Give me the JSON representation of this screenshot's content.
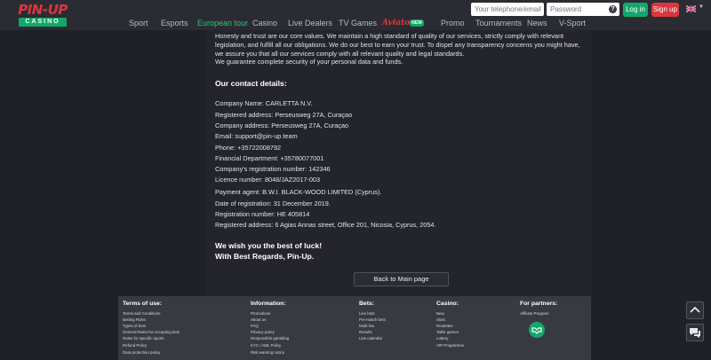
{
  "logo": {
    "top": "PIN-UP",
    "bottom": "CASINO"
  },
  "nav": {
    "items": [
      {
        "label": "Sport"
      },
      {
        "label": "Esports"
      },
      {
        "label": "European tour"
      },
      {
        "label": "Casino"
      },
      {
        "label": "Live Dealers"
      },
      {
        "label": "TV Games"
      },
      {
        "label": "Aviator"
      },
      {
        "label": "Promo"
      },
      {
        "label": "Tournaments"
      },
      {
        "label": "News"
      },
      {
        "label": "V-Sport"
      }
    ],
    "new_badge": "NEW"
  },
  "auth": {
    "phone_placeholder": "Your telephone/email",
    "password_placeholder": "Password",
    "help": "?",
    "login": "Log in",
    "signup": "Sign up"
  },
  "content": {
    "intro": "Honesty and trust are our core values. We maintain a high standard of quality of our services, strictly comply with relevant legislation, and fulfill all our obligations. We do our best to earn your trust. To dispel any transparency concerns you might have, we assure you that all our services comply with all relevant quality and legal standards.",
    "security": "We guarantee complete security of your personal data and funds.",
    "contact_heading": "Our contact details:",
    "details": [
      "Company Name: CARLETTA N.V.",
      "Registered address: Perseusweg 27A, Curaçao",
      "Company address: Perseusweg 27A, Curaçao",
      "Email: support@pin-up.team",
      "Phone: +35722008792",
      "Financial Department: +35780077001",
      "Company's registration number: 142346",
      "Licence number: 8048/JAZ2017-003"
    ],
    "agent": [
      "Payment agent: B.W.I. BLACK-WOOD LIMITED (Cyprus).",
      "Date of registration: 31 December 2019.",
      "Registration number: HE 405814",
      "Registered address: 6 Agias Annas street, Office 201, Nicosia, Cyprus, 2054."
    ],
    "closing_1": "We wish you the best of luck!",
    "closing_2": "With Best Regards, Pin-Up.",
    "back_button": "Back to Main page"
  },
  "footer": {
    "terms": {
      "title": "Terms of use:",
      "items": [
        "Terms and Conditions",
        "Betting Rules",
        "Types of bets",
        "General Rules for Accepting bets",
        "Rules for specific sports",
        "Refund Policy",
        "Data protection policy"
      ]
    },
    "information": {
      "title": "Information:",
      "items": [
        "Promotions",
        "About us",
        "FAQ",
        "Privacy policy",
        "Responsible gambling",
        "KYC / AML Policy",
        "Risk warning notice"
      ]
    },
    "bets": {
      "title": "Bets:",
      "items": [
        "Live bets",
        "Pre-match bets",
        "Multi-live",
        "Results",
        "Live calendar"
      ]
    },
    "casino": {
      "title": "Casino:",
      "items": [
        "New",
        "Slots",
        "Roulettes",
        "Table games",
        "Lottery",
        "VIP Programme"
      ]
    },
    "partners": {
      "title": "For partners:",
      "items": [
        "Affiliate Program"
      ]
    }
  },
  "colors": {
    "background": "#202127",
    "header": "#2b2c33",
    "brand_red": "#e0353d",
    "brand_green": "#12a86b",
    "footer": "#383a42"
  },
  "icons": [
    "help-icon",
    "uk-flag-icon",
    "chevron-down-icon",
    "partner-handshake-icon",
    "scroll-up-icon",
    "chat-icon"
  ]
}
